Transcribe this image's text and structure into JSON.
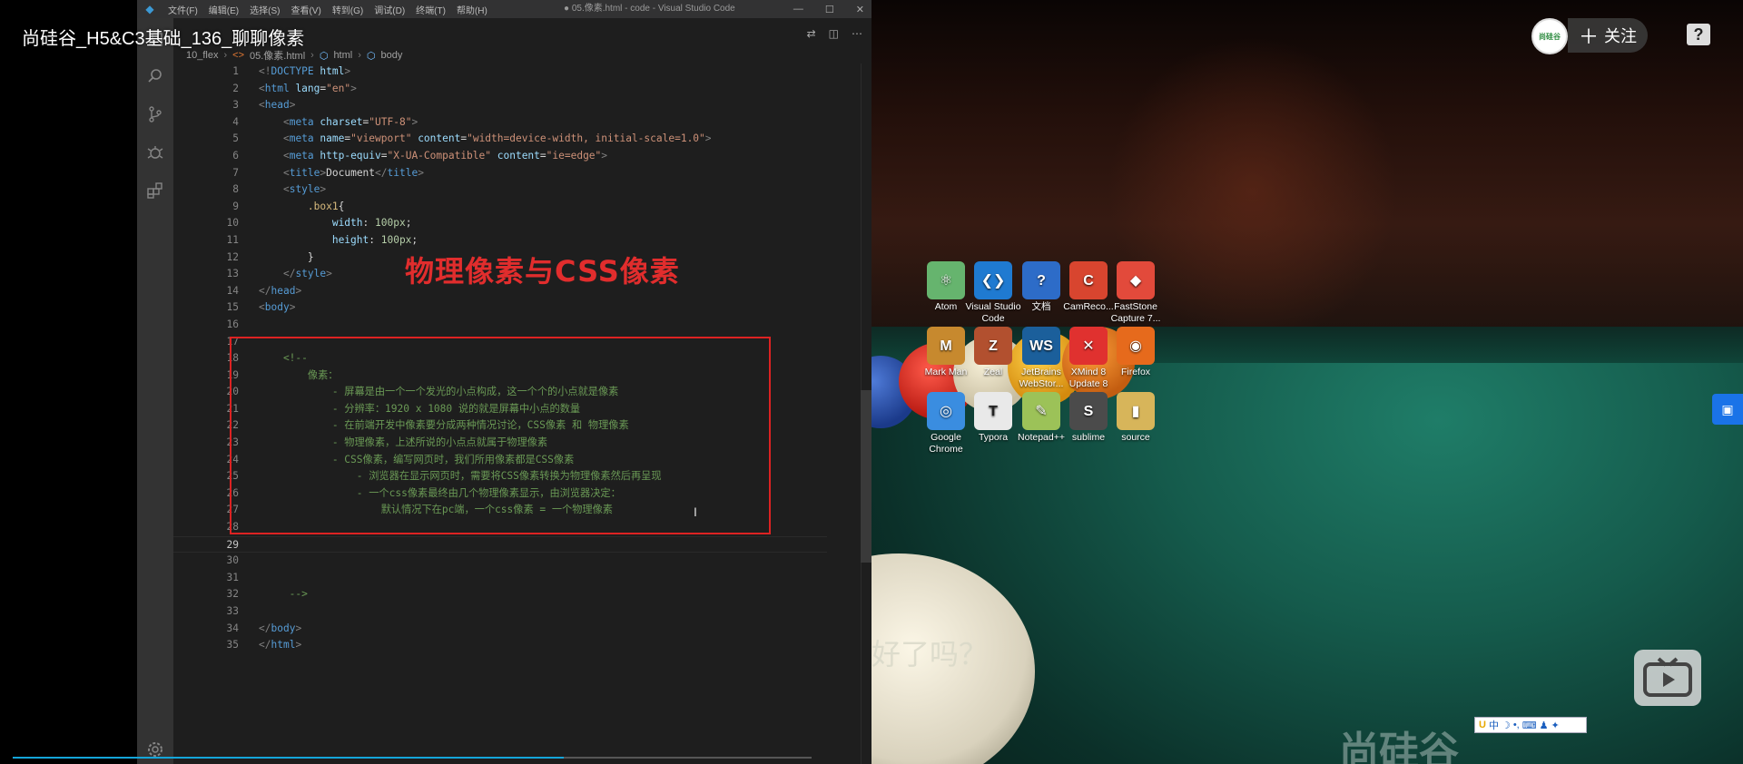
{
  "video": {
    "title": "尚硅谷_H5&C3基础_136_聊聊像素",
    "follow_label": "关注",
    "help_label": "?",
    "avatar_text": "尚硅谷",
    "progress_fraction": 0.69
  },
  "vscode": {
    "menu": [
      "文件(F)",
      "编辑(E)",
      "选择(S)",
      "查看(V)",
      "转到(G)",
      "调试(D)",
      "终端(T)",
      "帮助(H)"
    ],
    "window_title": "● 05.像素.html - code - Visual Studio Code",
    "breadcrumb": [
      "10_flex",
      "05.像素.html",
      "html",
      "body"
    ],
    "annotation": "物理像素与CSS像素",
    "active_line": 29
  },
  "code_lines": [
    {
      "n": "1",
      "segs": [
        [
          "punc",
          "<!"
        ],
        [
          "tag",
          "DOCTYPE"
        ],
        [
          "attr",
          " html"
        ],
        [
          "punc",
          ">"
        ]
      ]
    },
    {
      "n": "2",
      "segs": [
        [
          "punc",
          "<"
        ],
        [
          "tag",
          "html"
        ],
        [
          "attr",
          " lang"
        ],
        [
          "txt",
          "="
        ],
        [
          "str",
          "\"en\""
        ],
        [
          "punc",
          ">"
        ]
      ]
    },
    {
      "n": "3",
      "segs": [
        [
          "punc",
          "<"
        ],
        [
          "tag",
          "head"
        ],
        [
          "punc",
          ">"
        ]
      ]
    },
    {
      "n": "4",
      "segs": [
        [
          "txt",
          "    "
        ],
        [
          "punc",
          "<"
        ],
        [
          "tag",
          "meta"
        ],
        [
          "attr",
          " charset"
        ],
        [
          "txt",
          "="
        ],
        [
          "str",
          "\"UTF-8\""
        ],
        [
          "punc",
          ">"
        ]
      ]
    },
    {
      "n": "5",
      "segs": [
        [
          "txt",
          "    "
        ],
        [
          "punc",
          "<"
        ],
        [
          "tag",
          "meta"
        ],
        [
          "attr",
          " name"
        ],
        [
          "txt",
          "="
        ],
        [
          "str",
          "\"viewport\""
        ],
        [
          "attr",
          " content"
        ],
        [
          "txt",
          "="
        ],
        [
          "str",
          "\"width=device-width, initial-scale=1.0\""
        ],
        [
          "punc",
          ">"
        ]
      ]
    },
    {
      "n": "6",
      "segs": [
        [
          "txt",
          "    "
        ],
        [
          "punc",
          "<"
        ],
        [
          "tag",
          "meta"
        ],
        [
          "attr",
          " http-equiv"
        ],
        [
          "txt",
          "="
        ],
        [
          "str",
          "\"X-UA-Compatible\""
        ],
        [
          "attr",
          " content"
        ],
        [
          "txt",
          "="
        ],
        [
          "str",
          "\"ie=edge\""
        ],
        [
          "punc",
          ">"
        ]
      ]
    },
    {
      "n": "7",
      "segs": [
        [
          "txt",
          "    "
        ],
        [
          "punc",
          "<"
        ],
        [
          "tag",
          "title"
        ],
        [
          "punc",
          ">"
        ],
        [
          "txt",
          "Document"
        ],
        [
          "punc",
          "</"
        ],
        [
          "tag",
          "title"
        ],
        [
          "punc",
          ">"
        ]
      ]
    },
    {
      "n": "8",
      "segs": [
        [
          "txt",
          "    "
        ],
        [
          "punc",
          "<"
        ],
        [
          "tag",
          "style"
        ],
        [
          "punc",
          ">"
        ]
      ]
    },
    {
      "n": "9",
      "segs": [
        [
          "txt",
          "        "
        ],
        [
          "sel",
          ".box1"
        ],
        [
          "txt",
          "{"
        ]
      ]
    },
    {
      "n": "10",
      "segs": [
        [
          "txt",
          "            "
        ],
        [
          "prop",
          "width"
        ],
        [
          "txt",
          ": "
        ],
        [
          "num",
          "100px"
        ],
        [
          "txt",
          ";"
        ]
      ]
    },
    {
      "n": "11",
      "segs": [
        [
          "txt",
          "            "
        ],
        [
          "prop",
          "height"
        ],
        [
          "txt",
          ": "
        ],
        [
          "num",
          "100px"
        ],
        [
          "txt",
          ";"
        ]
      ]
    },
    {
      "n": "12",
      "segs": [
        [
          "txt",
          "        }"
        ]
      ]
    },
    {
      "n": "13",
      "segs": [
        [
          "txt",
          "    "
        ],
        [
          "punc",
          "</"
        ],
        [
          "tag",
          "style"
        ],
        [
          "punc",
          ">"
        ]
      ]
    },
    {
      "n": "14",
      "segs": [
        [
          "punc",
          "</"
        ],
        [
          "tag",
          "head"
        ],
        [
          "punc",
          ">"
        ]
      ]
    },
    {
      "n": "15",
      "segs": [
        [
          "punc",
          "<"
        ],
        [
          "tag",
          "body"
        ],
        [
          "punc",
          ">"
        ]
      ]
    },
    {
      "n": "16",
      "segs": []
    },
    {
      "n": "17",
      "segs": []
    },
    {
      "n": "18",
      "segs": [
        [
          "cmt",
          "    <!--"
        ]
      ]
    },
    {
      "n": "19",
      "segs": [
        [
          "cmt",
          "        像素："
        ]
      ]
    },
    {
      "n": "20",
      "segs": [
        [
          "cmt",
          "            - 屏幕是由一个一个发光的小点构成，这一个个的小点就是像素"
        ]
      ]
    },
    {
      "n": "21",
      "segs": [
        [
          "cmt",
          "            - 分辨率：1920 x 1080 说的就是屏幕中小点的数量"
        ]
      ]
    },
    {
      "n": "22",
      "segs": [
        [
          "cmt",
          "            - 在前端开发中像素要分成两种情况讨论，CSS像素 和 物理像素"
        ]
      ]
    },
    {
      "n": "23",
      "segs": [
        [
          "cmt",
          "            - 物理像素，上述所说的小点点就属于物理像素"
        ]
      ]
    },
    {
      "n": "24",
      "segs": [
        [
          "cmt",
          "            - CSS像素，编写网页时，我们所用像素都是CSS像素"
        ]
      ]
    },
    {
      "n": "25",
      "segs": [
        [
          "cmt",
          "                - 浏览器在显示网页时，需要将CSS像素转换为物理像素然后再呈现"
        ]
      ]
    },
    {
      "n": "26",
      "segs": [
        [
          "cmt",
          "                - 一个css像素最终由几个物理像素显示，由浏览器决定："
        ]
      ]
    },
    {
      "n": "27",
      "segs": [
        [
          "cmt",
          "                    默认情况下在pc端，一个css像素 = 一个物理像素"
        ]
      ]
    },
    {
      "n": "28",
      "segs": []
    },
    {
      "n": "29",
      "segs": []
    },
    {
      "n": "30",
      "segs": []
    },
    {
      "n": "31",
      "segs": []
    },
    {
      "n": "32",
      "segs": [
        [
          "cmt",
          "     -->"
        ]
      ]
    },
    {
      "n": "33",
      "segs": []
    },
    {
      "n": "34",
      "segs": [
        [
          "punc",
          "</"
        ],
        [
          "tag",
          "body"
        ],
        [
          "punc",
          ">"
        ]
      ]
    },
    {
      "n": "35",
      "segs": [
        [
          "punc",
          "</"
        ],
        [
          "tag",
          "html"
        ],
        [
          "punc",
          ">"
        ]
      ]
    }
  ],
  "desktop": {
    "icons": [
      {
        "label": "Atom",
        "color": "#66b46e",
        "glyph": "⚛"
      },
      {
        "label": "Visual Studio Code",
        "color": "#1f7ad1",
        "glyph": "❮❯"
      },
      {
        "label": "文档",
        "color": "#2d6cc8",
        "glyph": "?"
      },
      {
        "label": "CamReco...",
        "color": "#d8452f",
        "glyph": "C"
      },
      {
        "label": "FastStone Capture 7...",
        "color": "#e24a3b",
        "glyph": "◆"
      },
      {
        "label": "Mark Man",
        "color": "#c7892e",
        "glyph": "M"
      },
      {
        "label": "Zeal",
        "color": "#b2502f",
        "glyph": "Z"
      },
      {
        "label": "JetBrains WebStor...",
        "color": "#1b5f9b",
        "glyph": "WS"
      },
      {
        "label": "XMind 8 Update 8",
        "color": "#e0312f",
        "glyph": "✕"
      },
      {
        "label": "Firefox",
        "color": "#e66a1c",
        "glyph": "◉"
      },
      {
        "label": "Google Chrome",
        "color": "#3a8de0",
        "glyph": "◎"
      },
      {
        "label": "Typora",
        "color": "#e9e9e9",
        "glyph": "T"
      },
      {
        "label": "Notepad++",
        "color": "#9cc258",
        "glyph": "✎"
      },
      {
        "label": "sublime",
        "color": "#4b4b4b",
        "glyph": "S"
      },
      {
        "label": "source",
        "color": "#d7b55a",
        "glyph": "▮"
      }
    ],
    "slogan": "好了吗？",
    "watermark": "尚硅谷",
    "ime_label": "中"
  }
}
